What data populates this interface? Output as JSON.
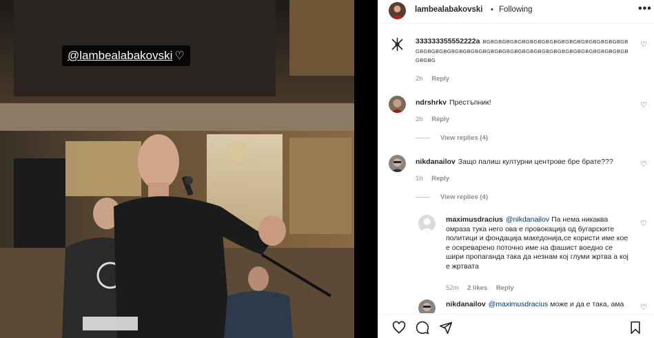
{
  "media": {
    "mention": "@lambealabakovski",
    "heart_icon": "white-heart-icon"
  },
  "header": {
    "username": "lambealabakovski",
    "separator": "•",
    "follow_status": "Following",
    "more": "•••"
  },
  "comments": [
    {
      "username": "333333355552222a",
      "text": "BGBGBGBGBGBGBGBGBGBGBGBGBGBGBGBGBGBGBGBGBGBGBGBGBGBGBGBGBGBGBGBGBGBGBGBGBGBGBGBGBGBGBGBGBGBGBGBG",
      "time": "2h",
      "reply": "Reply"
    },
    {
      "username": "ndrshrkv",
      "text": "Престъпник!",
      "time": "2h",
      "reply": "Reply",
      "view_replies": "View replies (4)"
    },
    {
      "username": "nikdanailov",
      "text": "Защо палиш културни центрове бре брате???",
      "time": "1h",
      "reply": "Reply",
      "view_replies": "View replies (4)"
    },
    {
      "username": "maximusdracius",
      "mention": "@nikdanailov",
      "text": "Па нема никаква омраза тука него ова е провокација од бугарските политици и фондација македонија,се користи име кое е оскреварено поточно име на фашист воедно се шири пропаганда така да незнам кој глуми жртва а кој е жртвата",
      "time": "52m",
      "likes": "2 likes",
      "reply": "Reply"
    },
    {
      "username": "nikdanailov",
      "mention": "@maximusdracius",
      "text": "може и да е така, ама"
    }
  ],
  "icons": {
    "like": "heart-outline-icon",
    "comment": "comment-icon",
    "share": "paper-plane-icon",
    "save": "bookmark-icon"
  },
  "colors": {
    "link": "#00376b",
    "secondary_text": "#8e8e8e",
    "divider": "#efefef"
  }
}
